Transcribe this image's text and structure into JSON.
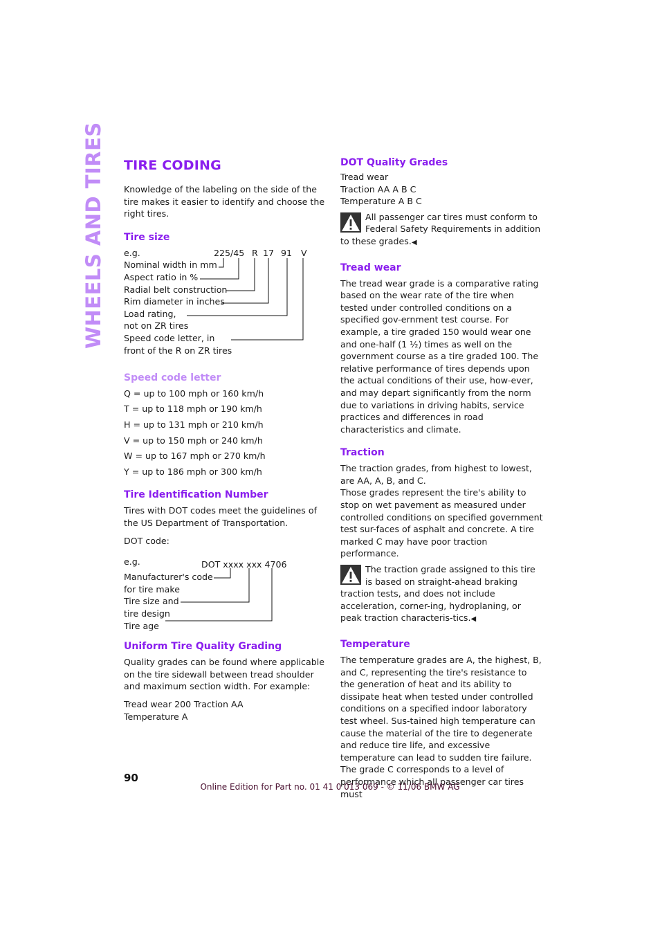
{
  "side_tab": "WHEELS AND TIRES",
  "left": {
    "title": "TIRE CODING",
    "intro": "Knowledge of the labeling on the side of the tire makes it easier to identify and choose the right tires.",
    "tire_size": {
      "heading": "Tire size",
      "eg": "e.g.",
      "codes": [
        "225/45",
        "R",
        "17",
        "91",
        "V"
      ],
      "labels": [
        "Nominal width in mm",
        "Aspect ratio in %",
        "Radial belt construction",
        "Rim diameter in inches",
        "Load rating,",
        "not on ZR tires",
        "Speed code letter, in",
        "front of the R on ZR tires"
      ]
    },
    "speed_code": {
      "heading": "Speed code letter",
      "items": [
        "Q = up to 100 mph or 160 km/h",
        "T = up to 118 mph or 190 km/h",
        "H = up to 131 mph or 210 km/h",
        "V = up to 150 mph or 240 km/h",
        "W = up to 167 mph or 270 km/h",
        "Y = up to 186 mph or 300 km/h"
      ]
    },
    "tin": {
      "heading": "Tire Identification Number",
      "text": "Tires with DOT codes meet the guidelines of the US Department of Transportation.",
      "dot_label": "DOT code:",
      "eg": "e.g.",
      "code": "DOT xxxx xxx 4706",
      "labels": [
        "Manufacturer's code",
        "for tire make",
        "Tire size and",
        "tire design",
        "Tire age"
      ]
    },
    "utqg": {
      "heading": "Uniform Tire Quality Grading",
      "text": "Quality grades can be found where applicable on the tire sidewall between tread shoulder and maximum section width. For example:",
      "example_1": "Tread wear 200 Traction AA",
      "example_2": "Temperature A"
    }
  },
  "right": {
    "dot_grades": {
      "heading": "DOT Quality Grades",
      "lines": [
        "Tread wear",
        "Traction AA A B C",
        "Temperature A B C"
      ],
      "warning": "All passenger car tires must conform to Federal Safety Requirements in addition to these grades."
    },
    "tread_wear": {
      "heading": "Tread wear",
      "text": "The tread wear grade is a comparative rating based on the wear rate of the tire when tested under controlled conditions on a specified gov-ernment test course. For example, a tire graded 150 would wear one and one-half (1 ½) times as well on the government course as a tire graded 100. The relative performance of tires depends upon the actual conditions of their use, how-ever, and may depart significantly from the norm due to variations in driving habits, service practices and differences in road characteristics and climate."
    },
    "traction": {
      "heading": "Traction",
      "text_1": "The traction grades, from highest to lowest, are AA, A, B, and C.",
      "text_2": "Those grades represent the tire's ability to stop on wet pavement as measured under controlled conditions on specified government test sur-faces of asphalt and concrete. A tire marked C may have poor traction performance.",
      "warning": "The traction grade assigned to this tire is based on straight-ahead braking traction tests, and does not include acceleration, corner-ing, hydroplaning, or peak traction characteris-tics."
    },
    "temperature": {
      "heading": "Temperature",
      "text": "The temperature grades are A, the highest, B, and C, representing the tire's resistance to the generation of heat and its ability to dissipate heat when tested under controlled conditions on a specified indoor laboratory test wheel. Sus-tained high temperature can cause the material of the tire to degenerate and reduce tire life, and excessive temperature can lead to sudden tire failure. The grade C corresponds to a level of performance which all passenger car tires must"
    }
  },
  "end_mark": "◀",
  "page_number": "90",
  "footer": "Online Edition for Part no. 01 41 0 013 069 - © 11/06 BMW AG"
}
